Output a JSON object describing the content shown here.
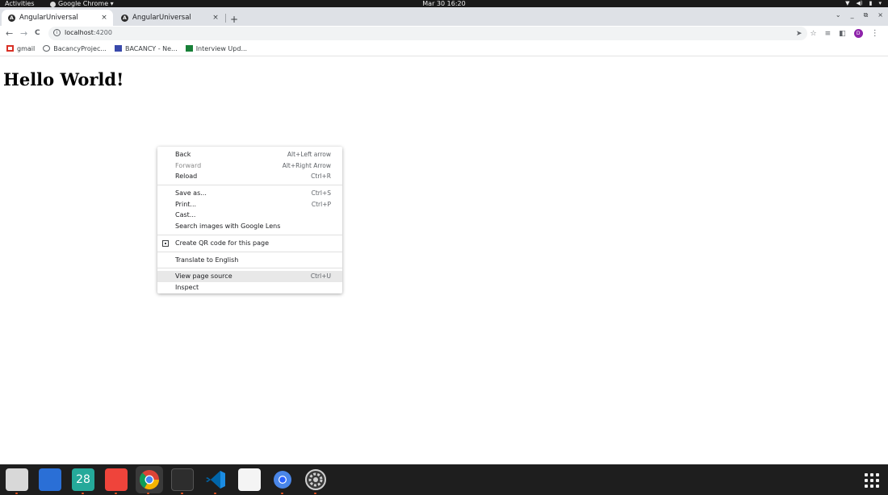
{
  "topbar": {
    "activities": "Activities",
    "app_name": "Google Chrome ▾",
    "clock": "Mar 30  16:20",
    "tray": [
      "▼",
      "◀)",
      "▮",
      "▾"
    ]
  },
  "tabs": [
    {
      "title": "AngularUniversal",
      "active": true,
      "close": "×"
    },
    {
      "title": "AngularUniversal",
      "active": false,
      "close": "×"
    }
  ],
  "new_tab": "+",
  "window_controls": [
    "⌄",
    "_",
    "⧉",
    "×"
  ],
  "toolbar": {
    "back": "←",
    "forward": "→",
    "reload": "C",
    "url_host": "localhost",
    "url_port": ":4200"
  },
  "bookmarks": [
    {
      "label": "gmail",
      "icon": "gmail-icon"
    },
    {
      "label": "BacancyProjec...",
      "icon": "globe-icon"
    },
    {
      "label": "BACANCY - Ne...",
      "icon": "bacancy-icon"
    },
    {
      "label": "Interview Upd...",
      "icon": "sheets-icon"
    }
  ],
  "page": {
    "heading": "Hello World!"
  },
  "context_menu": {
    "groups": [
      [
        {
          "label": "Back",
          "shortcut": "Alt+Left arrow"
        },
        {
          "label": "Forward",
          "shortcut": "Alt+Right Arrow",
          "disabled": true
        },
        {
          "label": "Reload",
          "shortcut": "Ctrl+R"
        }
      ],
      [
        {
          "label": "Save as...",
          "shortcut": "Ctrl+S"
        },
        {
          "label": "Print...",
          "shortcut": "Ctrl+P"
        },
        {
          "label": "Cast...",
          "shortcut": ""
        },
        {
          "label": "Search images with Google Lens",
          "shortcut": ""
        }
      ],
      [
        {
          "label": "Create QR code for this page",
          "shortcut": "",
          "icon": "qr-code-icon"
        }
      ],
      [
        {
          "label": "Translate to English",
          "shortcut": ""
        }
      ],
      [
        {
          "label": "View page source",
          "shortcut": "Ctrl+U",
          "highlighted": true
        },
        {
          "label": "Inspect",
          "shortcut": ""
        }
      ]
    ]
  },
  "dock": {
    "items": [
      {
        "name": "files",
        "color": "#d8d8d8"
      },
      {
        "name": "text-editor",
        "color": "#2a6fd6"
      },
      {
        "name": "calendar",
        "color": "#25a99a",
        "label": "28"
      },
      {
        "name": "anydesk",
        "color": "#ef443b"
      },
      {
        "name": "chrome",
        "color": "#e8e8e8"
      },
      {
        "name": "terminal",
        "color": "#2d2d2d"
      },
      {
        "name": "vscode",
        "color": "#1b8ce3"
      },
      {
        "name": "notes",
        "color": "#f4f4f4"
      },
      {
        "name": "chromium",
        "color": "#4a86e8"
      },
      {
        "name": "settings",
        "color": "#cfcfcf"
      }
    ]
  },
  "colors": {
    "accent_running": "#e95420",
    "tabstrip": "#dee1e6",
    "highlight": "#e8e8e8"
  }
}
